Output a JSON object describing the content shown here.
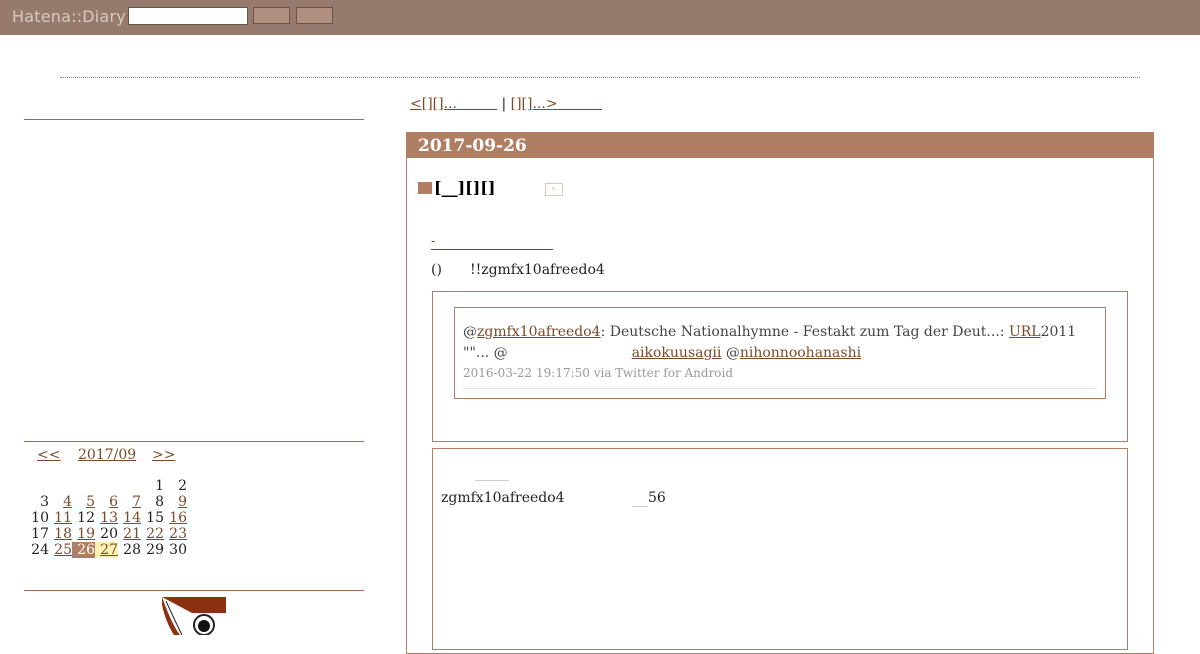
{
  "header": {
    "logo": "Hatena::Diary",
    "search_value": "",
    "button1": "",
    "button2": ""
  },
  "calendar": {
    "prev": "<<",
    "month": "2017/09",
    "next": ">>",
    "weeks": [
      [
        "",
        "",
        "",
        "",
        "",
        "1",
        "2"
      ],
      [
        "3",
        "4",
        "5",
        "6",
        "7",
        "8",
        "9"
      ],
      [
        "10",
        "11",
        "12",
        "13",
        "14",
        "15",
        "16"
      ],
      [
        "17",
        "18",
        "19",
        "20",
        "21",
        "22",
        "23"
      ],
      [
        "24",
        "25",
        "26",
        "27",
        "28",
        "29",
        "30"
      ]
    ],
    "linked_days": [
      "4",
      "5",
      "6",
      "7",
      "9",
      "11",
      "13",
      "14",
      "16",
      "18",
      "19",
      "21",
      "22",
      "23",
      "25",
      "26",
      "27"
    ],
    "today": "26",
    "highlight": "27",
    "colors": {
      "accent": "#b07e62",
      "highlight": "#fdf2b4"
    }
  },
  "pager": {
    "prev": "<[][]...",
    "sep": " | ",
    "next": "[][]...>"
  },
  "day": {
    "date": "2017-09-26",
    "section_title": "[__][][]",
    "edit_icon": "edit-icon",
    "dash_link": "-",
    "line1_left": "()",
    "line1_user": "!!zgmfx10afreedo4",
    "tweet": {
      "at1": "@",
      "user1": "zgmfx10afreedo4",
      "text1": ": Deutsche Nationalhymne - Festakt zum Tag der Deut...: ",
      "url_label": "URL",
      "year": "2011",
      "line2_prefix": "\"\"... @",
      "user2": "aikokuusagii",
      "at3": " @",
      "user3": "nihonnoohanashi",
      "meta": "2016-03-22 19:17:50 via Twitter for Android"
    },
    "box2": {
      "user": "zgmfx10afreedo4",
      "number": "56"
    }
  }
}
